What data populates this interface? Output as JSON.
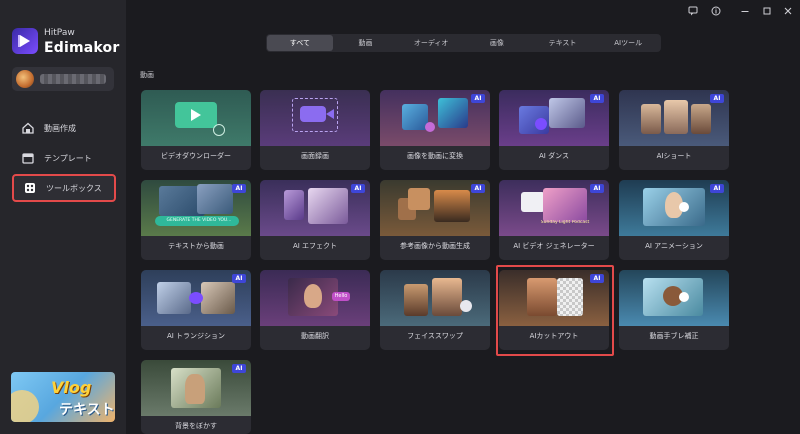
{
  "app": {
    "brand_small": "HitPaw",
    "brand_name": "Edimakor"
  },
  "sidebar": {
    "items": [
      {
        "label": "動画作成",
        "icon": "home-icon"
      },
      {
        "label": "テンプレート",
        "icon": "template-icon"
      },
      {
        "label": "ツールボックス",
        "icon": "toolbox-icon",
        "active": true
      }
    ],
    "promo": {
      "title": "Vlog",
      "subtitle": "テキスト"
    }
  },
  "tabs": [
    {
      "label": "すべて",
      "active": true
    },
    {
      "label": "動画"
    },
    {
      "label": "オーディオ"
    },
    {
      "label": "画像"
    },
    {
      "label": "テキスト"
    },
    {
      "label": "AIツール"
    }
  ],
  "section": {
    "label": "動画"
  },
  "ai_badge": "AI",
  "tools": [
    {
      "label": "ビデオダウンローダー",
      "ai": false
    },
    {
      "label": "画面録画",
      "ai": false
    },
    {
      "label": "画像を動画に変換",
      "ai": true
    },
    {
      "label": "AI ダンス",
      "ai": true
    },
    {
      "label": "AIショート",
      "ai": true
    },
    {
      "label": "テキストから動画",
      "ai": true,
      "art_text": "GENERATE THE VIDEO YOU..."
    },
    {
      "label": "AI エフェクト",
      "ai": true
    },
    {
      "label": "参考画像から動画生成",
      "ai": true
    },
    {
      "label": "AI ビデオ ジェネレーター",
      "ai": true,
      "art_text": "Sunday Light Podcast"
    },
    {
      "label": "AI アニメーション",
      "ai": true
    },
    {
      "label": "AI トランジション",
      "ai": true
    },
    {
      "label": "動画翻訳",
      "ai": false,
      "art_text": "Hello"
    },
    {
      "label": "フェイススワップ",
      "ai": false
    },
    {
      "label": "AIカットアウト",
      "ai": true,
      "highlighted": true
    },
    {
      "label": "動画手ブレ補正",
      "ai": false
    },
    {
      "label": "背景をぼかす",
      "ai": true
    }
  ],
  "colors": {
    "accent": "#3e46d8",
    "highlight": "#e34a4a",
    "background": "#1b1b1f",
    "sidebar": "#26262b"
  }
}
